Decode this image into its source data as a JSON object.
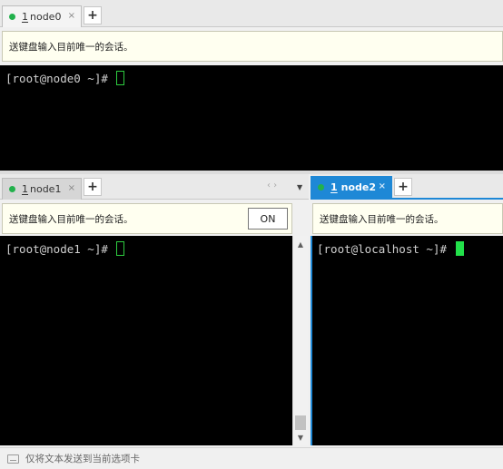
{
  "top_pane": {
    "tab": {
      "number": "1",
      "name": "node0",
      "close": "×"
    },
    "plus": "+",
    "broadcast_text": "送键盘输入目前唯一的会话。",
    "prompt": "[root@node0 ~]# "
  },
  "left_pane": {
    "tab": {
      "number": "1",
      "name": "node1",
      "close": "×"
    },
    "plus": "+",
    "nav_arrows": "‹ ›",
    "dropdown": "▼",
    "broadcast_text": "送键盘输入目前唯一的会话。",
    "on_button": "ON",
    "prompt": "[root@node1 ~]# "
  },
  "right_pane": {
    "tab": {
      "number": "1",
      "name": "node2",
      "close": "×"
    },
    "plus": "+",
    "broadcast_text": "送键盘输入目前唯一的会话。",
    "prompt": "[root@localhost ~]# "
  },
  "scrollbar": {
    "up": "▲",
    "down": "▼"
  },
  "status_bar": {
    "text": "仅将文本发送到当前选项卡",
    "icon": "keyboard-icon"
  },
  "colors": {
    "active_tab": "#1e88d6",
    "cursor": "#22e04a",
    "status_dot": "#22b14c",
    "terminal_bg": "#000000",
    "broadcast_bg": "#fffff0"
  }
}
